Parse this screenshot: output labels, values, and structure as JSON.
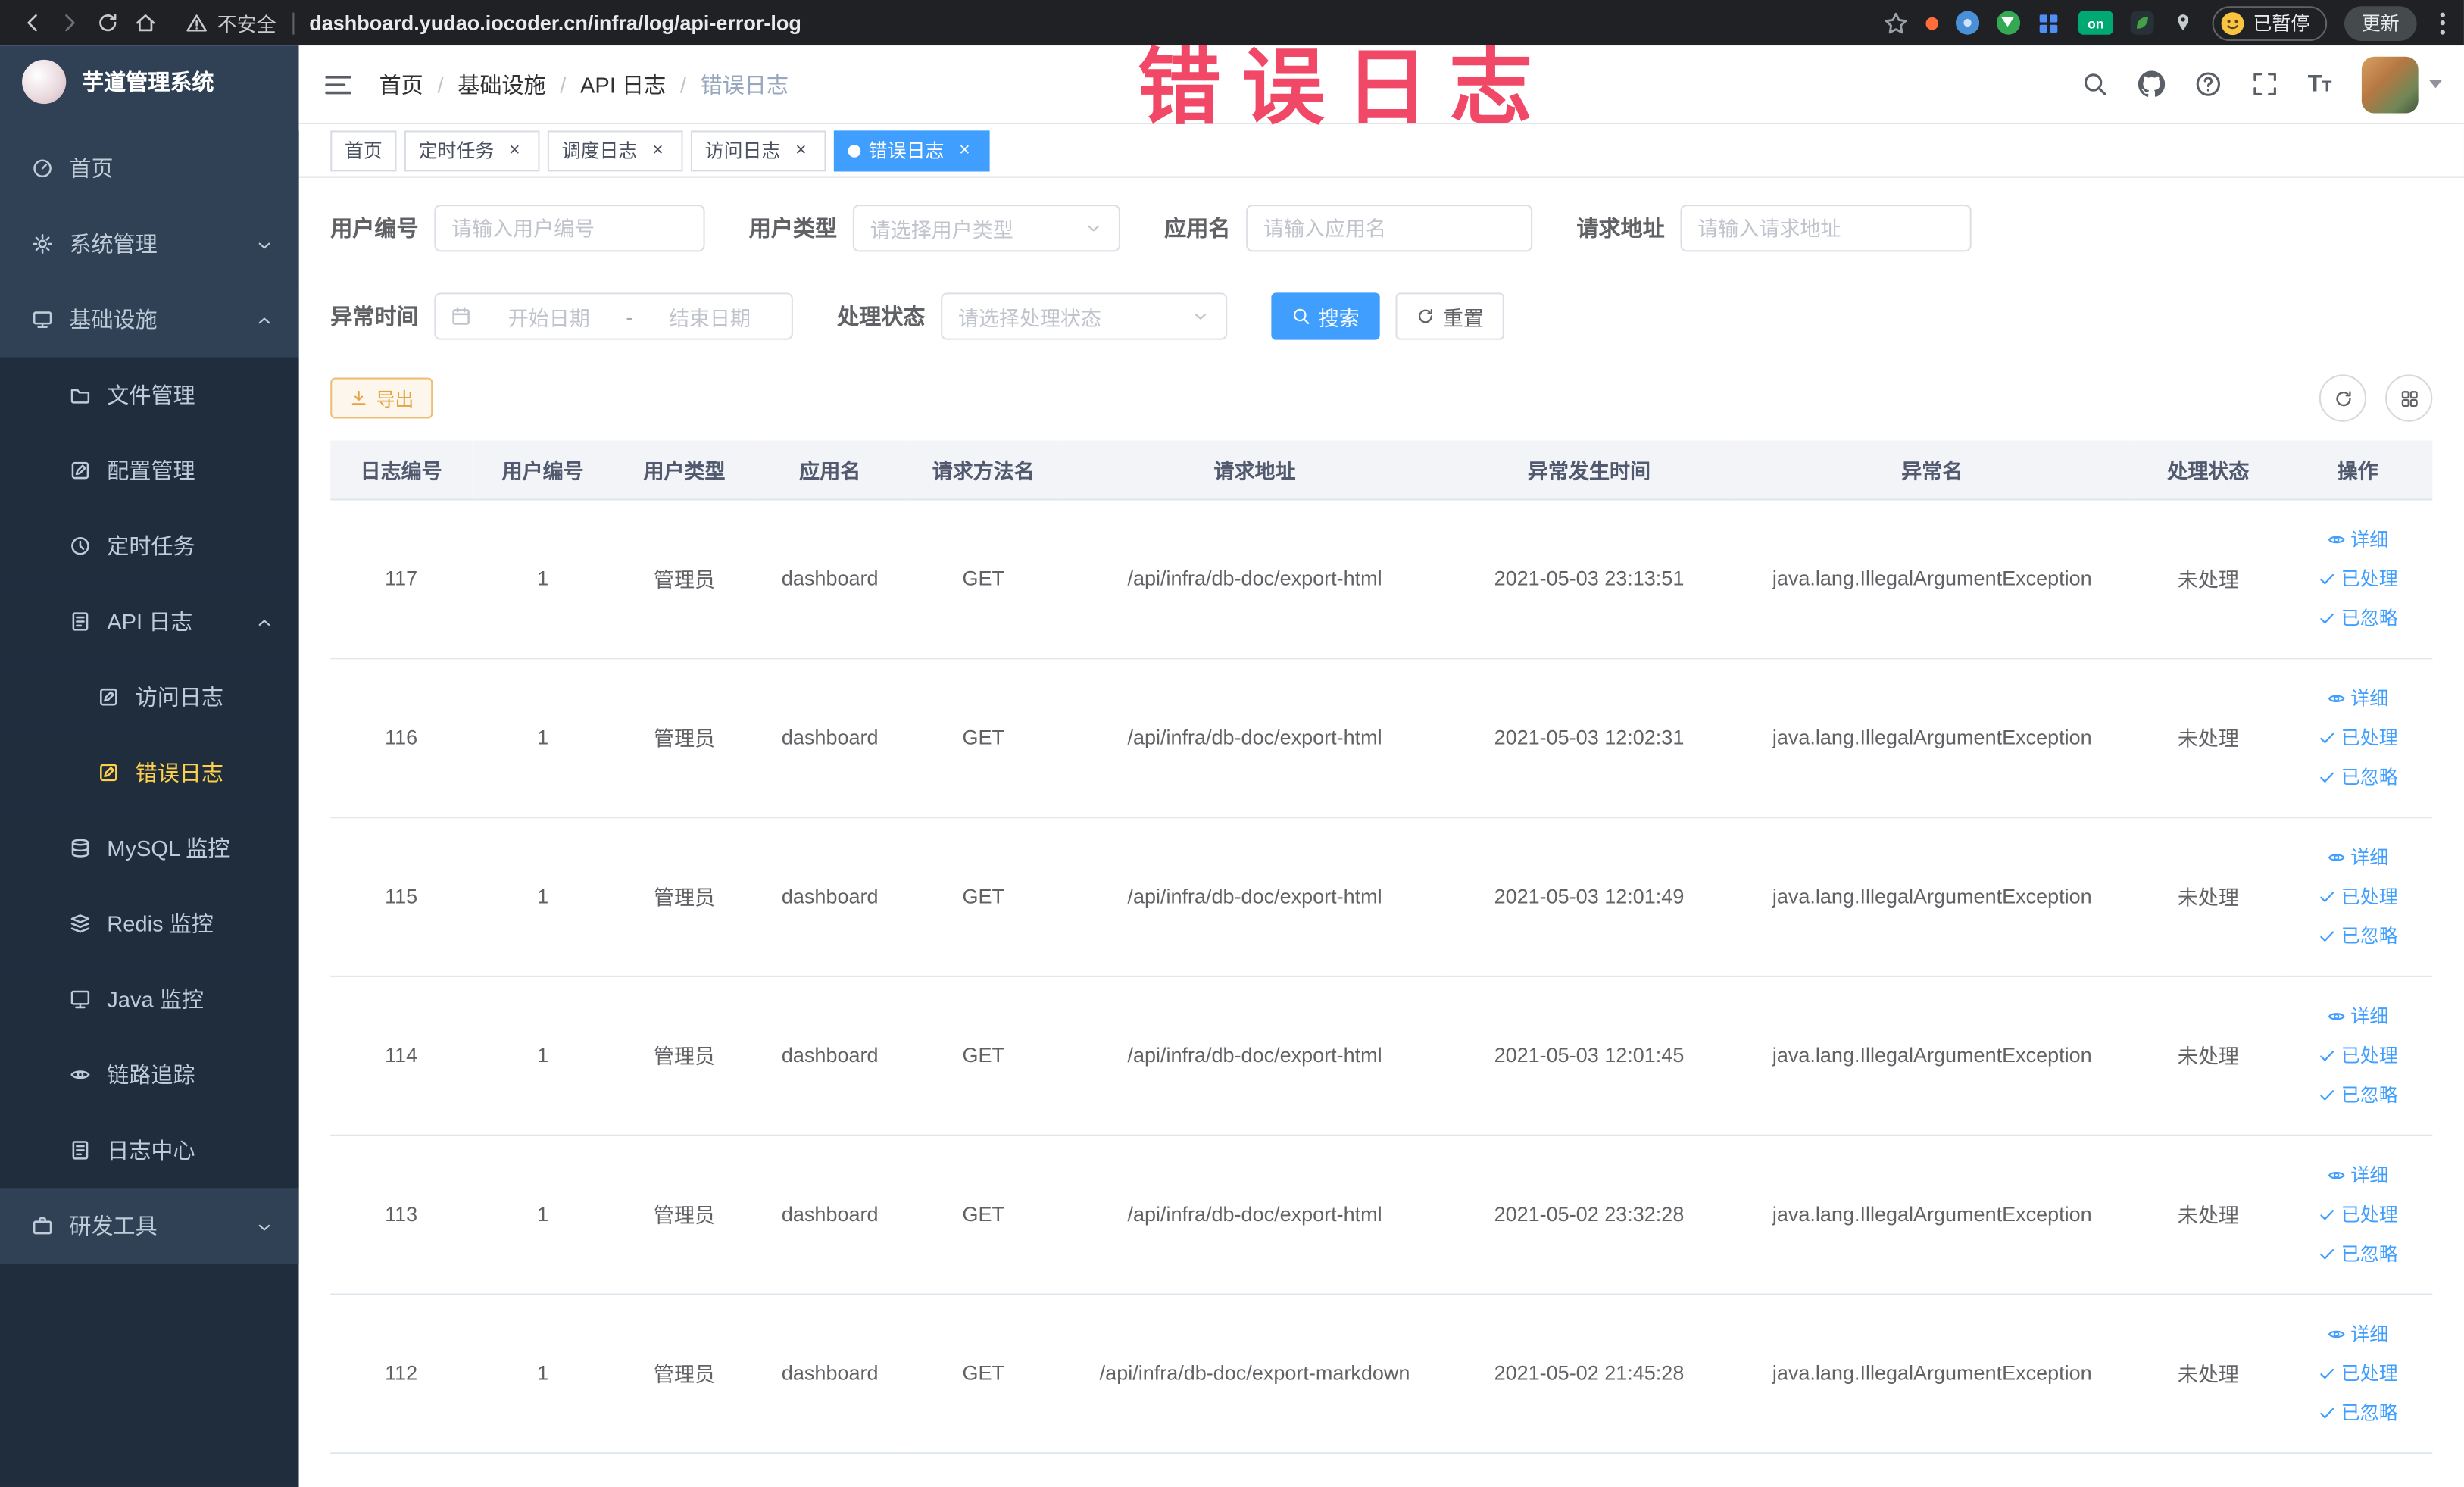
{
  "theme": {
    "primary": "#409eff",
    "sidebar_bg": "#304156",
    "submenu_bg": "#1f2d3d",
    "active_menu_text": "#ffd04b",
    "warning": "#e6a23c",
    "annotation_color": "#f04866"
  },
  "browser": {
    "security_label": "不安全",
    "url": "dashboard.yudao.iocoder.cn/infra/log/api-error-log",
    "on_badge": "on",
    "paused_button": "已暂停",
    "update_button": "更新"
  },
  "annotation": {
    "title": "错误日志"
  },
  "sidebar": {
    "logo_title": "芋道管理系统",
    "items": [
      {
        "label": "首页",
        "icon": "dashboard-icon",
        "depth": 0
      },
      {
        "label": "系统管理",
        "icon": "gear-icon",
        "depth": 0,
        "arrow": "down"
      },
      {
        "label": "基础设施",
        "icon": "infra-icon",
        "depth": 0,
        "arrow": "up"
      },
      {
        "label": "文件管理",
        "icon": "folder-icon",
        "depth": 1
      },
      {
        "label": "配置管理",
        "icon": "edit-icon",
        "depth": 1
      },
      {
        "label": "定时任务",
        "icon": "timer-icon",
        "depth": 1
      },
      {
        "label": "API 日志",
        "icon": "log-icon",
        "depth": 1,
        "arrow": "up"
      },
      {
        "label": "访问日志",
        "icon": "edit-icon",
        "depth": 2
      },
      {
        "label": "错误日志",
        "icon": "edit-icon",
        "depth": 2,
        "active": true
      },
      {
        "label": "MySQL 监控",
        "icon": "mysql-icon",
        "depth": 1
      },
      {
        "label": "Redis 监控",
        "icon": "redis-icon",
        "depth": 1
      },
      {
        "label": "Java 监控",
        "icon": "java-icon",
        "depth": 1
      },
      {
        "label": "链路追踪",
        "icon": "trace-icon",
        "depth": 1
      },
      {
        "label": "日志中心",
        "icon": "log-center-icon",
        "depth": 1
      },
      {
        "label": "研发工具",
        "icon": "tool-icon",
        "depth": 0,
        "arrow": "down"
      }
    ]
  },
  "header": {
    "breadcrumb": [
      "首页",
      "基础设施",
      "API 日志",
      "错误日志"
    ]
  },
  "tabs": [
    {
      "label": "首页",
      "closable": false,
      "active": false
    },
    {
      "label": "定时任务",
      "closable": true,
      "active": false
    },
    {
      "label": "调度日志",
      "closable": true,
      "active": false
    },
    {
      "label": "访问日志",
      "closable": true,
      "active": false
    },
    {
      "label": "错误日志",
      "closable": true,
      "active": true
    }
  ],
  "filters": {
    "user_id": {
      "label": "用户编号",
      "placeholder": "请输入用户编号"
    },
    "user_type": {
      "label": "用户类型",
      "placeholder": "请选择用户类型"
    },
    "app_name": {
      "label": "应用名",
      "placeholder": "请输入应用名"
    },
    "request_url": {
      "label": "请求地址",
      "placeholder": "请输入请求地址"
    },
    "exception_time": {
      "label": "异常时间",
      "start_placeholder": "开始日期",
      "separator": "-",
      "end_placeholder": "结束日期"
    },
    "process_status": {
      "label": "处理状态",
      "placeholder": "请选择处理状态"
    },
    "search_button": "搜索",
    "reset_button": "重置"
  },
  "toolbar": {
    "export_button": "导出"
  },
  "table": {
    "headers": [
      "日志编号",
      "用户编号",
      "用户类型",
      "应用名",
      "请求方法名",
      "请求地址",
      "异常发生时间",
      "异常名",
      "处理状态",
      "操作"
    ],
    "actions": [
      "详细",
      "已处理",
      "已忽略"
    ],
    "rows": [
      {
        "id": "117",
        "user_id": "1",
        "user_type": "管理员",
        "app": "dashboard",
        "method": "GET",
        "url": "/api/infra/db-doc/export-html",
        "time": "2021-05-03 23:13:51",
        "exception": "java.lang.IllegalArgumentException",
        "status": "未处理"
      },
      {
        "id": "116",
        "user_id": "1",
        "user_type": "管理员",
        "app": "dashboard",
        "method": "GET",
        "url": "/api/infra/db-doc/export-html",
        "time": "2021-05-03 12:02:31",
        "exception": "java.lang.IllegalArgumentException",
        "status": "未处理"
      },
      {
        "id": "115",
        "user_id": "1",
        "user_type": "管理员",
        "app": "dashboard",
        "method": "GET",
        "url": "/api/infra/db-doc/export-html",
        "time": "2021-05-03 12:01:49",
        "exception": "java.lang.IllegalArgumentException",
        "status": "未处理"
      },
      {
        "id": "114",
        "user_id": "1",
        "user_type": "管理员",
        "app": "dashboard",
        "method": "GET",
        "url": "/api/infra/db-doc/export-html",
        "time": "2021-05-03 12:01:45",
        "exception": "java.lang.IllegalArgumentException",
        "status": "未处理"
      },
      {
        "id": "113",
        "user_id": "1",
        "user_type": "管理员",
        "app": "dashboard",
        "method": "GET",
        "url": "/api/infra/db-doc/export-html",
        "time": "2021-05-02 23:32:28",
        "exception": "java.lang.IllegalArgumentException",
        "status": "未处理"
      },
      {
        "id": "112",
        "user_id": "1",
        "user_type": "管理员",
        "app": "dashboard",
        "method": "GET",
        "url": "/api/infra/db-doc/export-markdown",
        "time": "2021-05-02 21:45:28",
        "exception": "java.lang.IllegalArgumentException",
        "status": "未处理"
      }
    ]
  }
}
